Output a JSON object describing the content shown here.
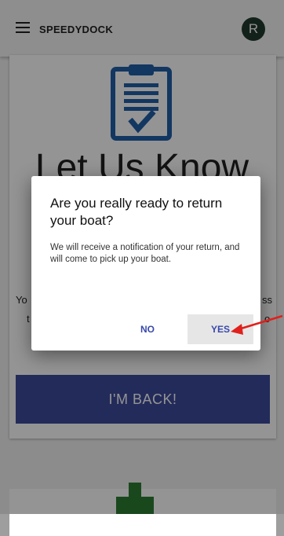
{
  "app": {
    "title": "SPEEDYDOCK",
    "avatar_letter": "R"
  },
  "main": {
    "headline": "Let Us Know",
    "side_text_left": "Yo",
    "side_text_left2": "t",
    "side_text_right": "ss",
    "side_text_right2": "o",
    "back_button_label": "I'M BACK!"
  },
  "dialog": {
    "title": "Are you really ready to return your boat?",
    "body": "We will receive a notification of your return, and will come to pick up your boat.",
    "no_label": "NO",
    "yes_label": "YES"
  },
  "colors": {
    "primary": "#3d4a9c",
    "dialog_button_text": "#3949ab",
    "clipboard_blue": "#1f5fa8",
    "arrow_red": "#e0201c"
  }
}
